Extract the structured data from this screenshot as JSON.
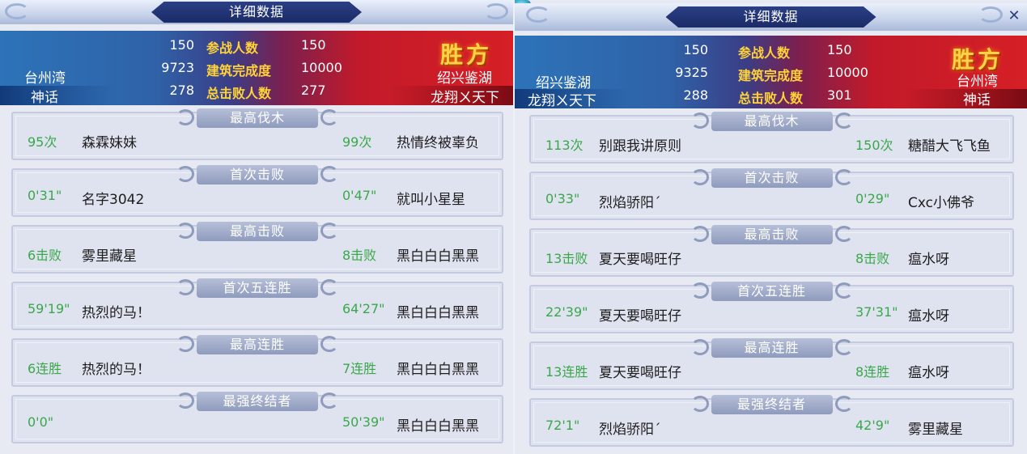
{
  "panels": [
    {
      "title": "详细数据",
      "left_server": "台州湾",
      "left_guild": "神话",
      "right_server": "绍兴鉴湖",
      "right_guild": "龙翔ㄨ天下",
      "winner_label": "胜方",
      "stats": [
        {
          "label": "参战人数",
          "left": "150",
          "right": "150"
        },
        {
          "label": "建筑完成度",
          "left": "9723",
          "right": "10000"
        },
        {
          "label": "总击败人数",
          "left": "278",
          "right": "277"
        }
      ],
      "rows": [
        {
          "label": "最高伐木",
          "left_value": "95次",
          "left_name": "森霖妹妹",
          "right_value": "99次",
          "right_name": "热情终被辜负"
        },
        {
          "label": "首次击败",
          "left_value": "0'31\"",
          "left_name": "名字3042",
          "right_value": "0'47\"",
          "right_name": "就叫小星星"
        },
        {
          "label": "最高击败",
          "left_value": "6击败",
          "left_name": "雾里藏星",
          "right_value": "8击败",
          "right_name": "黑白白白黑黑"
        },
        {
          "label": "首次五连胜",
          "left_value": "59'19\"",
          "left_name": "热烈的马！",
          "right_value": "64'27\"",
          "right_name": "黑白白白黑黑"
        },
        {
          "label": "最高连胜",
          "left_value": "6连胜",
          "left_name": "热烈的马！",
          "right_value": "7连胜",
          "right_name": "黑白白白黑黑"
        },
        {
          "label": "最强终结者",
          "left_value": "0'0\"",
          "left_name": "",
          "right_value": "50'39\"",
          "right_name": "黑白白白黑黑"
        }
      ]
    },
    {
      "title": "详细数据",
      "left_server": "绍兴鉴湖",
      "left_guild": "龙翔ㄨ天下",
      "right_server": "台州湾",
      "right_guild": "神话",
      "winner_label": "胜方",
      "stats": [
        {
          "label": "参战人数",
          "left": "150",
          "right": "150"
        },
        {
          "label": "建筑完成度",
          "left": "9325",
          "right": "10000"
        },
        {
          "label": "总击败人数",
          "left": "288",
          "right": "301"
        }
      ],
      "rows": [
        {
          "label": "最高伐木",
          "left_value": "113次",
          "left_name": "别跟我讲原则",
          "right_value": "150次",
          "right_name": "糖醋大飞飞鱼"
        },
        {
          "label": "首次击败",
          "left_value": "0'33\"",
          "left_name": "烈焰骄阳ˊ",
          "right_value": "0'29\"",
          "right_name": "Cxc小佛爷"
        },
        {
          "label": "最高击败",
          "left_value": "13击败",
          "left_name": "夏天要喝旺仔",
          "right_value": "8击败",
          "right_name": "瘟水呀"
        },
        {
          "label": "首次五连胜",
          "left_value": "22'39\"",
          "left_name": "夏天要喝旺仔",
          "right_value": "37'31\"",
          "right_name": "瘟水呀"
        },
        {
          "label": "最高连胜",
          "left_value": "13连胜",
          "left_name": "夏天要喝旺仔",
          "right_value": "8连胜",
          "right_name": "瘟水呀"
        },
        {
          "label": "最强终结者",
          "left_value": "72'1\"",
          "left_name": "烈焰骄阳ˊ",
          "right_value": "42'9\"",
          "right_name": "雾里藏星"
        }
      ]
    }
  ],
  "close_glyph": "✕"
}
